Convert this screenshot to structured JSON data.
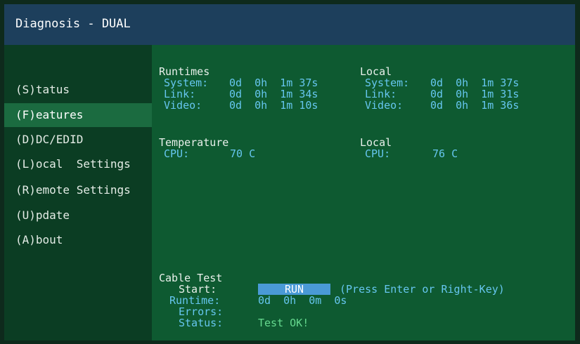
{
  "window": {
    "title": "Diagnosis - DUAL"
  },
  "sidebar": {
    "items": [
      {
        "label": "(S)tatus"
      },
      {
        "label": "(F)eatures",
        "active": true
      },
      {
        "label": "(D)DC/EDID"
      },
      {
        "label": "(L)ocal  Settings"
      },
      {
        "label": "(R)emote Settings"
      },
      {
        "label": "(U)pdate"
      },
      {
        "label": "(A)bout"
      }
    ]
  },
  "runtimes": {
    "title": "Runtimes",
    "rows": [
      {
        "label": "System:",
        "value": "0d  0h  1m 37s"
      },
      {
        "label": "Link:",
        "value": "0d  0h  1m 34s"
      },
      {
        "label": "Video:",
        "value": "0d  0h  1m 10s"
      }
    ]
  },
  "runtimes_local": {
    "title": "Local",
    "rows": [
      {
        "label": "System:",
        "value": "0d  0h  1m 37s"
      },
      {
        "label": "Link:",
        "value": "0d  0h  1m 31s"
      },
      {
        "label": "Video:",
        "value": "0d  0h  1m 36s"
      }
    ]
  },
  "temperature": {
    "title": "Temperature",
    "cpu_label": "CPU:",
    "cpu_value": "70 C"
  },
  "temperature_local": {
    "title": "Local",
    "cpu_label": "CPU:",
    "cpu_value": "76 C"
  },
  "cable_test": {
    "title": "Cable Test",
    "start_label": "Start:",
    "run_button": "RUN",
    "hint": "(Press Enter or Right-Key)",
    "runtime_label": "Runtime:",
    "runtime_value": "0d  0h  0m  0s",
    "errors_label": "Errors:",
    "errors_value": "",
    "status_label": "Status:",
    "status_value": "Test OK!"
  },
  "colors": {
    "titlebar": "#1d3f5c",
    "content_bg": "#0e5a31",
    "sidebar_bg": "#0b3d23",
    "active_item": "#1b6b40",
    "value_text": "#66c6ef",
    "ok_text": "#66d98f",
    "button": "#4a9ad6"
  }
}
